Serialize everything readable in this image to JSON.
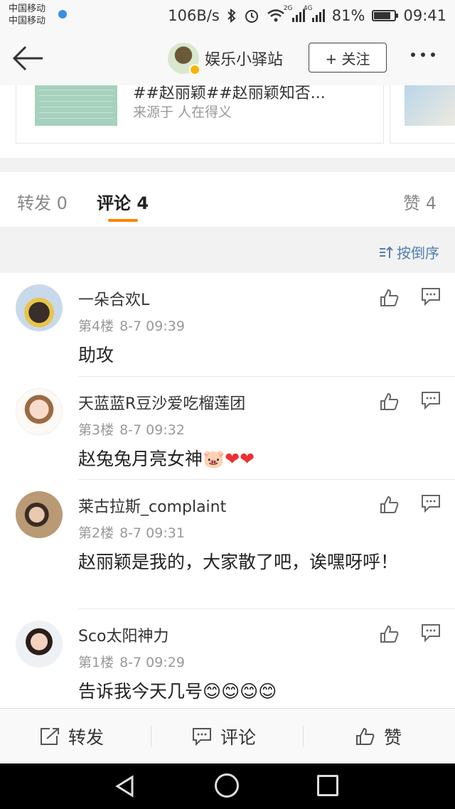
{
  "status_bar": {
    "carrier_1": "中国移动",
    "carrier_2": "中国移动",
    "net_speed": "106B/s",
    "sig1_label": "2G",
    "sig2_label": "4G",
    "battery_percent": "81%",
    "battery_level": 0.81,
    "time": "09:41",
    "icons": [
      "bluetooth-icon",
      "alarm-icon",
      "wifi-icon",
      "signal-icon",
      "battery-icon"
    ]
  },
  "nav": {
    "back_icon": "arrow-left-icon",
    "account_name": "娱乐小驿站",
    "follow_label": "+ 关注",
    "more_icon": "more-dots-icon"
  },
  "repost_card": {
    "title": "##赵丽颖##赵丽颖知否...",
    "source": "来源于 人在得义"
  },
  "tabs": {
    "repost": "转发 0",
    "comment": "评论 4",
    "like": "赞 4"
  },
  "sort": {
    "label": "按倒序"
  },
  "comments": [
    {
      "name": "一朵合欢L",
      "floor": "第4楼",
      "time": "8-7 09:39",
      "text": "助攻"
    },
    {
      "name": "天蓝蓝R豆沙爱吃榴莲团",
      "floor": "第3楼",
      "time": "8-7 09:32",
      "text": "赵兔兔月亮女神",
      "emoji": "🐷",
      "hearts": "❤❤"
    },
    {
      "name": "莱古拉斯_complaint",
      "floor": "第2楼",
      "time": "8-7 09:31",
      "text": "赵丽颖是我的，大家散了吧，诶嘿呀呼！"
    },
    {
      "name": "Sco太阳神力",
      "floor": "第1楼",
      "time": "8-7 09:29",
      "text": "告诉我今天几号",
      "emoji": "😊😊😊😊"
    }
  ],
  "action_bar": {
    "repost": "转发",
    "comment": "评论",
    "like": "赞"
  },
  "colors": {
    "accent_orange": "#ff8200",
    "link_blue": "#507daf",
    "heart_red": "#e83232"
  }
}
